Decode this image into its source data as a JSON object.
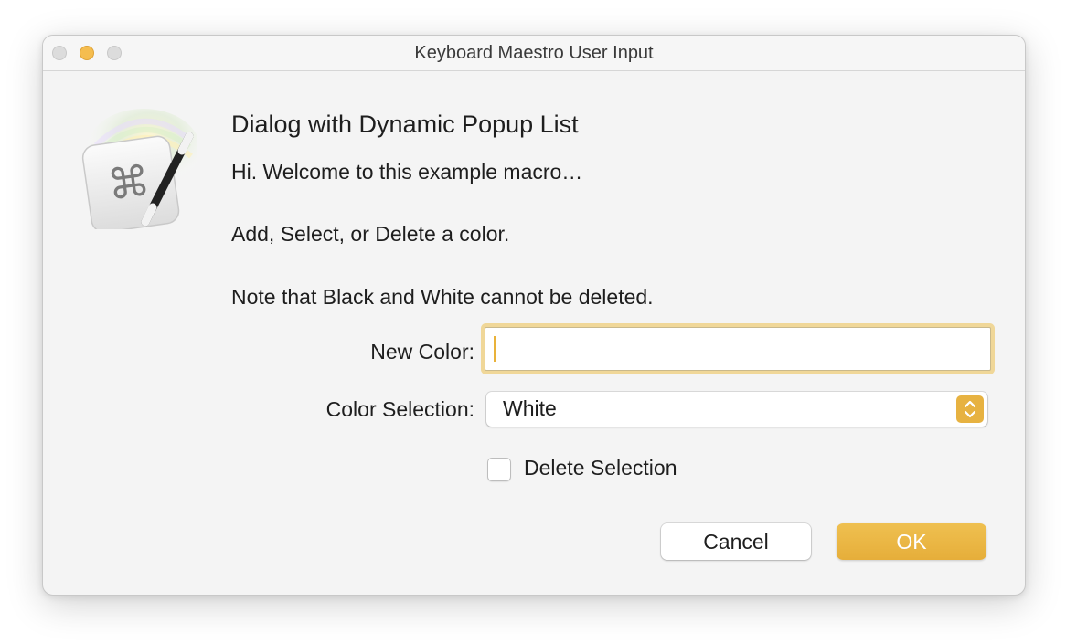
{
  "window": {
    "title": "Keyboard Maestro User Input"
  },
  "icons": {
    "app": "keyboard-maestro-app-icon",
    "popup": "chevron-up-down-icon"
  },
  "dialog": {
    "heading": "Dialog with Dynamic Popup List",
    "messages": [
      "Hi. Welcome to this example macro…",
      "Add, Select, or Delete a color.",
      "Note that Black and White cannot be deleted."
    ],
    "new_color": {
      "label": "New Color:",
      "value": ""
    },
    "color_selection": {
      "label": "Color Selection:",
      "value": "White"
    },
    "delete_checkbox": {
      "label": "Delete Selection",
      "checked": false
    },
    "buttons": {
      "cancel": "Cancel",
      "ok": "OK"
    }
  },
  "colors": {
    "accent": "#e6ae3a",
    "focus_ring": "#f0d798",
    "window_bg": "#f4f4f4"
  }
}
